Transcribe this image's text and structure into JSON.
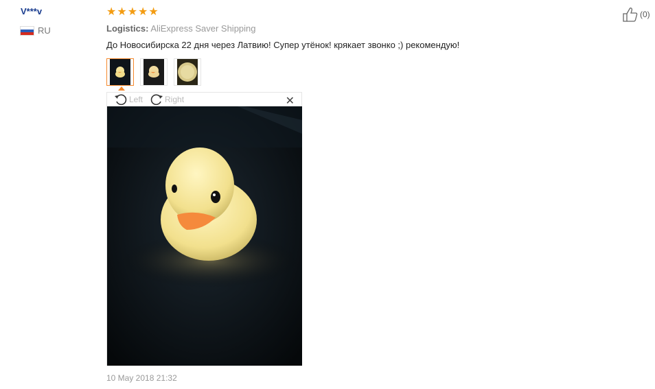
{
  "reviewer": {
    "name": "V***v",
    "country": "RU",
    "flag_colors": [
      "#ffffff",
      "#2c5db8",
      "#d52b1e"
    ]
  },
  "review": {
    "rating": 5,
    "max_rating": 5,
    "star_color": "#f39c12",
    "logistics_label": "Logistics:",
    "logistics_value": "AliExpress Saver Shipping",
    "text": "До Новосибирска 22 дня через Латвию! Супер утёнок! крякает звонко ;) рекомендую!",
    "date": "10 May 2018 21:32",
    "likes": "(0)"
  },
  "viewer": {
    "rotate_left_label": "Left",
    "rotate_right_label": "Right",
    "close_icon": "close-icon",
    "active_thumb_color": "#f5882b"
  },
  "thumbnails": [
    {
      "name": "duck-photo-1",
      "active": true
    },
    {
      "name": "duck-photo-2",
      "active": false
    },
    {
      "name": "duck-photo-3",
      "active": false
    }
  ]
}
